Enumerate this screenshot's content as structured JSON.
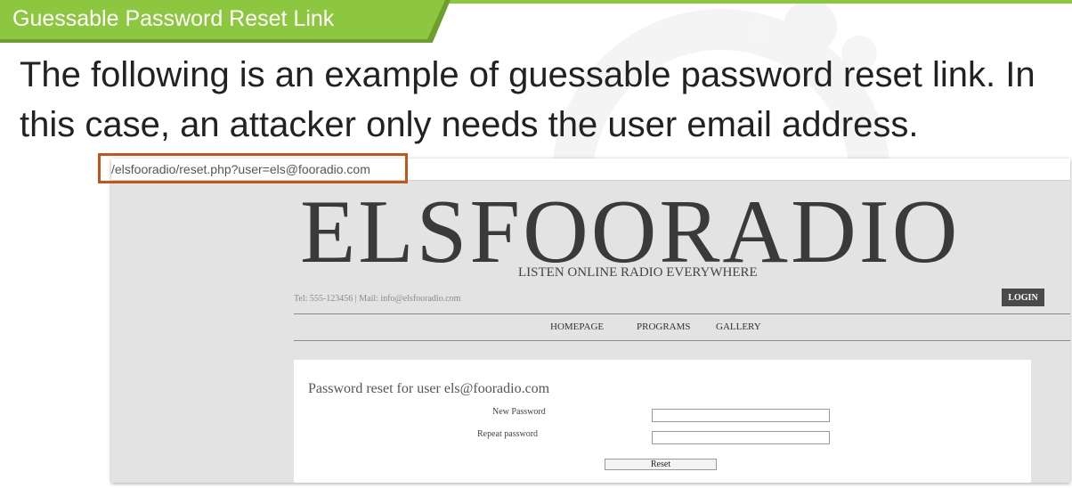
{
  "slide": {
    "title": "Guessable Password Reset Link",
    "body": "The following is an example of guessable password reset link. In this case, an attacker only needs the user email address."
  },
  "browser": {
    "url": "/elsfooradio/reset.php?user=els@fooradio.com"
  },
  "site": {
    "logo": "ELSFOORADIO",
    "tagline": "LISTEN ONLINE RADIO EVERYWHERE",
    "contact": "Tel: 555-123456 | Mail: info@elsfooradio.com",
    "login_label": "LOGIN",
    "nav": [
      "HOMEPAGE",
      "PROGRAMS",
      "GALLERY"
    ]
  },
  "reset_form": {
    "title": "Password reset for user els@fooradio.com",
    "new_password_label": "New Password",
    "new_password_value": "",
    "repeat_password_label": "Repeat password",
    "repeat_password_value": "",
    "submit_label": "Reset"
  },
  "colors": {
    "accent_green": "#8dc63f",
    "highlight_orange": "#c0561a"
  }
}
